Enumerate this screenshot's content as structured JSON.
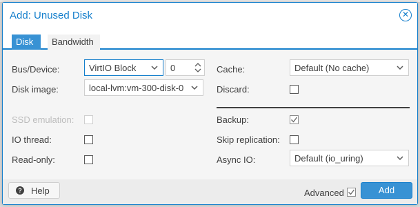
{
  "dialog": {
    "title": "Add: Unused Disk"
  },
  "tabs": [
    {
      "label": "Disk",
      "active": true
    },
    {
      "label": "Bandwidth",
      "active": false
    }
  ],
  "left": {
    "bus_device_label": "Bus/Device:",
    "bus_value": "VirtIO Block",
    "device_value": "0",
    "disk_image_label": "Disk image:",
    "disk_image_value": "local-lvm:vm-300-disk-0",
    "ssd_label": "SSD emulation:",
    "ssd_checked": false,
    "ssd_disabled": true,
    "io_thread_label": "IO thread:",
    "io_thread_checked": false,
    "read_only_label": "Read-only:",
    "read_only_checked": false
  },
  "right": {
    "cache_label": "Cache:",
    "cache_value": "Default (No cache)",
    "discard_label": "Discard:",
    "discard_checked": false,
    "backup_label": "Backup:",
    "backup_checked": true,
    "skip_replication_label": "Skip replication:",
    "skip_replication_checked": false,
    "async_io_label": "Async IO:",
    "async_io_value": "Default (io_uring)"
  },
  "footer": {
    "help_label": "Help",
    "advanced_label": "Advanced",
    "advanced_checked": true,
    "add_label": "Add"
  },
  "colors": {
    "accent": "#157fcc",
    "tab_active": "#3892d4",
    "text": "#404040",
    "disabled_text": "#bdbdbd"
  },
  "icons": {
    "close": "close-circle-icon",
    "help": "question-circle-icon",
    "dropdown": "chevron-down-icon",
    "spinner": "spinner-arrows-icon",
    "check": "checkmark-icon"
  }
}
